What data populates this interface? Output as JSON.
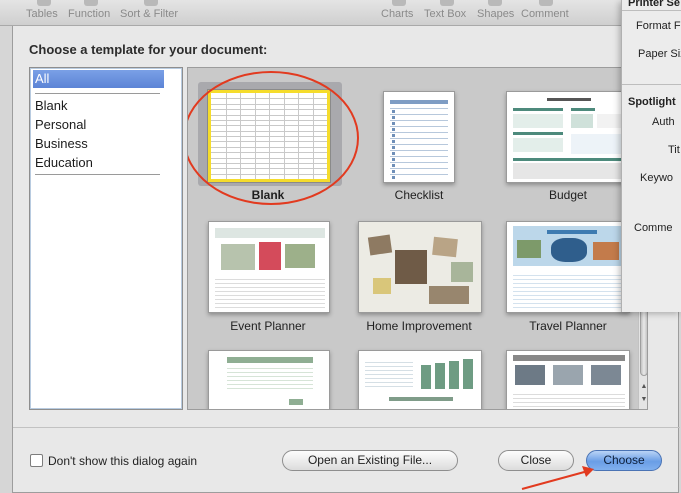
{
  "toolbar": {
    "items": [
      {
        "label": "Tables"
      },
      {
        "label": "Function"
      },
      {
        "label": "Sort & Filter"
      },
      {
        "label": "Charts"
      },
      {
        "label": "Text Box"
      },
      {
        "label": "Shapes"
      },
      {
        "label": "Comment"
      }
    ]
  },
  "inspector": {
    "printer_section": "Printer Se",
    "format_label": "Format F",
    "paper_size_label": "Paper Siz",
    "spotlight_section": "Spotlight",
    "author_label": "Auth",
    "title_label": "Tit",
    "keywords_label": "Keywo",
    "comments_label": "Comme"
  },
  "dialog": {
    "title": "Choose a template for your document:",
    "categories": [
      {
        "label": "All"
      },
      {
        "label": "Blank"
      },
      {
        "label": "Personal"
      },
      {
        "label": "Business"
      },
      {
        "label": "Education"
      }
    ],
    "templates": [
      {
        "label": "Blank"
      },
      {
        "label": "Checklist"
      },
      {
        "label": "Budget"
      },
      {
        "label": "Event Planner"
      },
      {
        "label": "Home Improvement"
      },
      {
        "label": "Travel Planner"
      },
      {
        "label": ""
      },
      {
        "label": ""
      },
      {
        "label": ""
      }
    ],
    "selected_template": "Blank",
    "dont_show_label": "Don't show this dialog again",
    "dont_show_checked": false,
    "open_existing_label": "Open an Existing File...",
    "close_label": "Close",
    "choose_label": "Choose"
  },
  "colors": {
    "selection_highlight": "#5c84d6",
    "selected_border": "#f5dc2c",
    "annotation_red": "#e23a1f",
    "primary_button": "#6a9ee6"
  }
}
